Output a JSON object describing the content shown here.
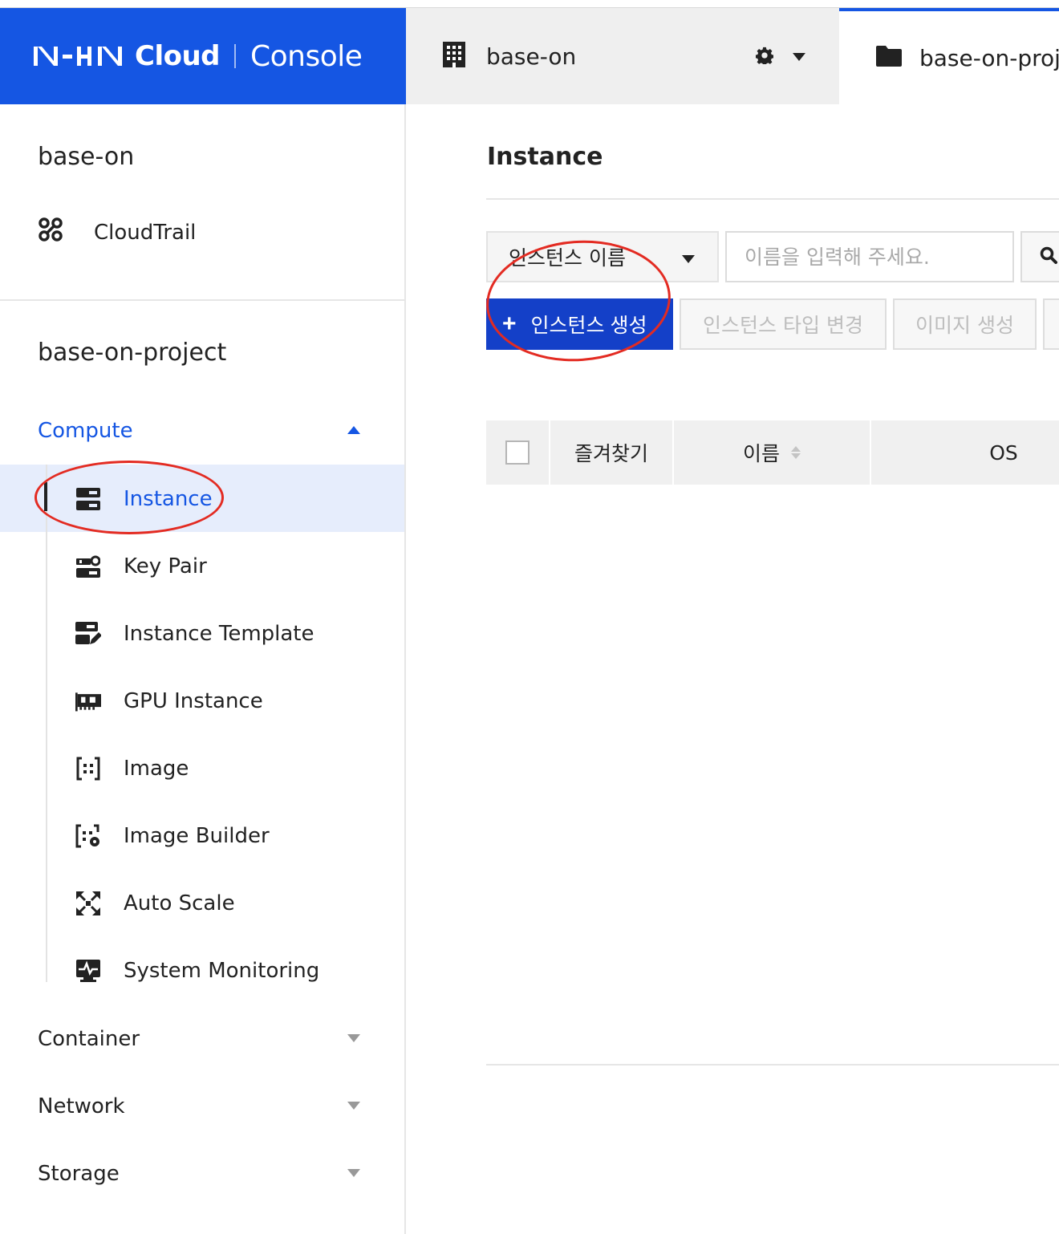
{
  "header": {
    "logo_brand": "NHN",
    "logo_product": "Cloud",
    "logo_console": "Console",
    "org_name": "base-on",
    "project_tab": "base-on-proje"
  },
  "sidebar": {
    "org_name": "base-on",
    "cloudtrail_label": "CloudTrail",
    "project_name": "base-on-project",
    "categories": {
      "compute": "Compute",
      "container": "Container",
      "network": "Network",
      "storage": "Storage"
    },
    "compute_items": [
      {
        "label": "Instance",
        "icon": "server-icon",
        "active": true
      },
      {
        "label": "Key Pair",
        "icon": "key-pair-icon",
        "active": false
      },
      {
        "label": "Instance Template",
        "icon": "template-icon",
        "active": false
      },
      {
        "label": "GPU Instance",
        "icon": "gpu-icon",
        "active": false
      },
      {
        "label": "Image",
        "icon": "image-icon",
        "active": false
      },
      {
        "label": "Image Builder",
        "icon": "image-builder-icon",
        "active": false
      },
      {
        "label": "Auto Scale",
        "icon": "auto-scale-icon",
        "active": false
      },
      {
        "label": "System Monitoring",
        "icon": "monitoring-icon",
        "active": false
      }
    ]
  },
  "main": {
    "title": "Instance",
    "search": {
      "filter_selected": "인스턴스 이름",
      "placeholder": "이름을 입력해 주세요."
    },
    "actions": {
      "create_label": "인스턴스 생성",
      "change_type_label": "인스턴스 타입 변경",
      "create_image_label": "이미지 생성"
    },
    "table": {
      "columns": [
        "즐겨찾기",
        "이름",
        "OS"
      ]
    }
  },
  "colors": {
    "brand_blue": "#1556e3",
    "button_blue": "#1440c8",
    "annotation_red": "#e32b22",
    "active_bg": "#e6edfc"
  }
}
